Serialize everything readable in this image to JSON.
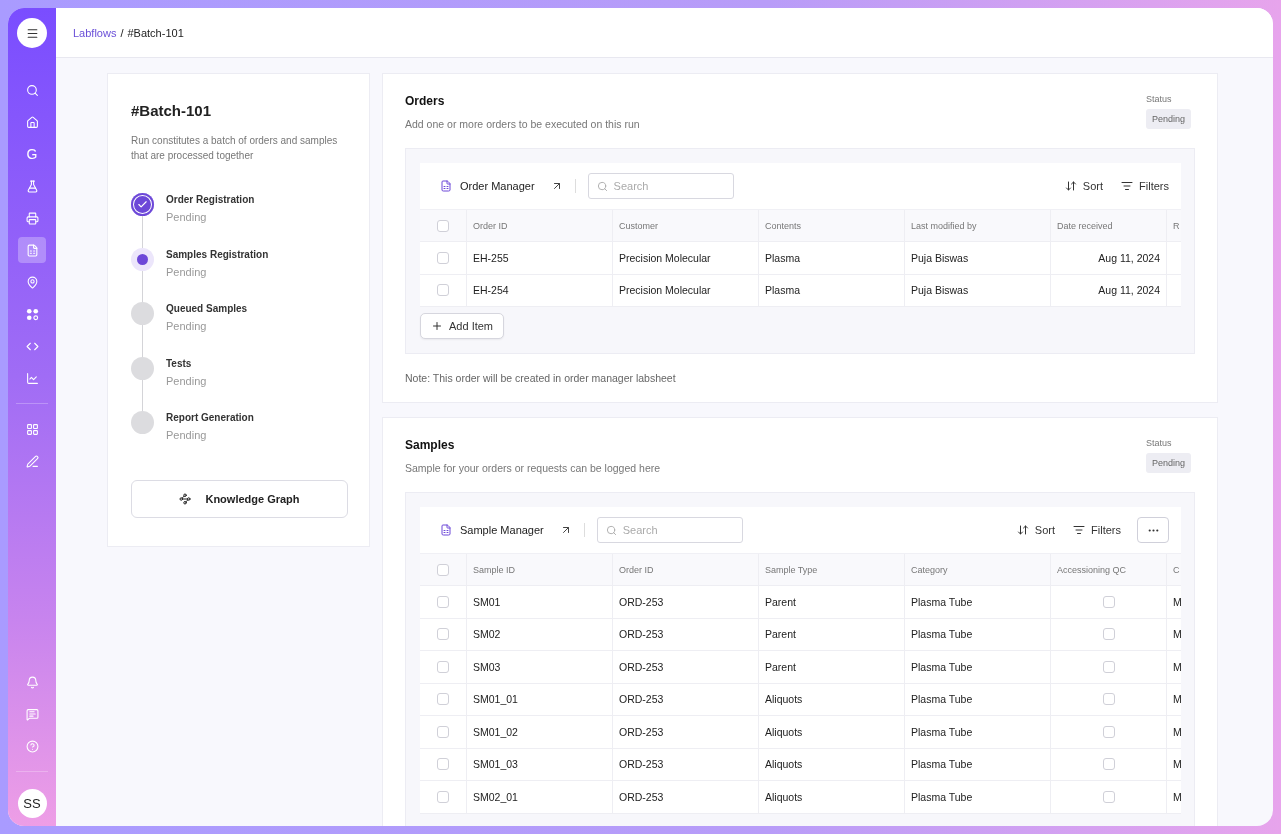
{
  "breadcrumb": {
    "parent": "Labflows",
    "separator": "/",
    "current": "#Batch-101"
  },
  "sidebar": {
    "items": [
      {
        "kind": "search",
        "selected": false
      },
      {
        "kind": "home",
        "selected": false
      },
      {
        "kind": "letter",
        "label": "G",
        "selected": false
      },
      {
        "kind": "flask",
        "selected": false
      },
      {
        "kind": "printer",
        "selected": false
      },
      {
        "kind": "sheet",
        "selected": true
      },
      {
        "kind": "pin",
        "selected": false
      },
      {
        "kind": "dots",
        "selected": false
      },
      {
        "kind": "code",
        "selected": false
      },
      {
        "kind": "chart",
        "selected": false
      },
      {
        "kind": "divider"
      },
      {
        "kind": "grid",
        "selected": false
      },
      {
        "kind": "pen",
        "selected": false
      }
    ],
    "footer_items": [
      {
        "kind": "bell"
      },
      {
        "kind": "chat"
      },
      {
        "kind": "help"
      }
    ],
    "avatar": "SS"
  },
  "run": {
    "title": "#Batch-101",
    "description": "Run constitutes a batch of orders and samples that are processed together",
    "steps": [
      {
        "name": "Order Registration",
        "status": "Pending",
        "kind": "done"
      },
      {
        "name": "Samples Registration",
        "status": "Pending",
        "kind": "current"
      },
      {
        "name": "Queued Samples",
        "status": "Pending",
        "kind": "pending"
      },
      {
        "name": "Tests",
        "status": "Pending",
        "kind": "pending"
      },
      {
        "name": "Report Generation",
        "status": "Pending",
        "kind": "pending"
      }
    ],
    "button": "Knowledge Graph"
  },
  "sections": [
    {
      "title": "Orders",
      "description": "Add one or more orders to be executed on this run",
      "status_label": "Status",
      "status": "Pending",
      "table": {
        "name": "Order Manager",
        "search_placeholder": "Search",
        "sort": "Sort",
        "filters": "Filters",
        "more_button": false,
        "all_checked": false,
        "columns": [
          {
            "label": "Order ID",
            "kind": "text"
          },
          {
            "label": "Customer",
            "kind": "text"
          },
          {
            "label": "Contents",
            "kind": "text"
          },
          {
            "label": "Last modified by",
            "kind": "text"
          },
          {
            "label": "Date received",
            "kind": "date"
          },
          {
            "label": "R",
            "kind": "cut"
          }
        ],
        "rows": [
          {
            "checked": false,
            "cells": [
              "EH-255",
              "Precision Molecular",
              "Plasma",
              "Puja Biswas",
              "Aug 11, 2024"
            ]
          },
          {
            "checked": false,
            "cells": [
              "EH-254",
              "Precision Molecular",
              "Plasma",
              "Puja Biswas",
              "Aug 11, 2024"
            ]
          }
        ]
      },
      "add_button": "Add Item",
      "note": "Note: This order will be created in order manager labsheet"
    },
    {
      "title": "Samples",
      "description": "Sample for your orders or requests can be logged here",
      "status_label": "Status",
      "status": "Pending",
      "table": {
        "name": "Sample Manager",
        "search_placeholder": "Search",
        "sort": "Sort",
        "filters": "Filters",
        "more_button": true,
        "all_checked": false,
        "columns": [
          {
            "label": "Sample ID",
            "kind": "text"
          },
          {
            "label": "Order ID",
            "kind": "text"
          },
          {
            "label": "Sample Type",
            "kind": "text"
          },
          {
            "label": "Category",
            "kind": "text"
          },
          {
            "label": "Accessioning QC",
            "kind": "checkbox"
          },
          {
            "label": "C",
            "kind": "cut"
          }
        ],
        "rows": [
          {
            "checked": false,
            "cells": [
              "SM01",
              "ORD-253",
              "Parent",
              "Plasma Tube",
              false,
              "M"
            ]
          },
          {
            "checked": false,
            "cells": [
              "SM02",
              "ORD-253",
              "Parent",
              "Plasma Tube",
              false,
              "M"
            ]
          },
          {
            "checked": false,
            "cells": [
              "SM03",
              "ORD-253",
              "Parent",
              "Plasma Tube",
              false,
              "M"
            ]
          },
          {
            "checked": false,
            "cells": [
              "SM01_01",
              "ORD-253",
              "Aliquots",
              "Plasma Tube",
              false,
              "M"
            ]
          },
          {
            "checked": false,
            "cells": [
              "SM01_02",
              "ORD-253",
              "Aliquots",
              "Plasma Tube",
              false,
              "M"
            ]
          },
          {
            "checked": false,
            "cells": [
              "SM01_03",
              "ORD-253",
              "Aliquots",
              "Plasma Tube",
              false,
              "M"
            ]
          },
          {
            "checked": false,
            "cells": [
              "SM02_01",
              "ORD-253",
              "Aliquots",
              "Plasma Tube",
              false,
              "M"
            ]
          }
        ]
      }
    }
  ]
}
